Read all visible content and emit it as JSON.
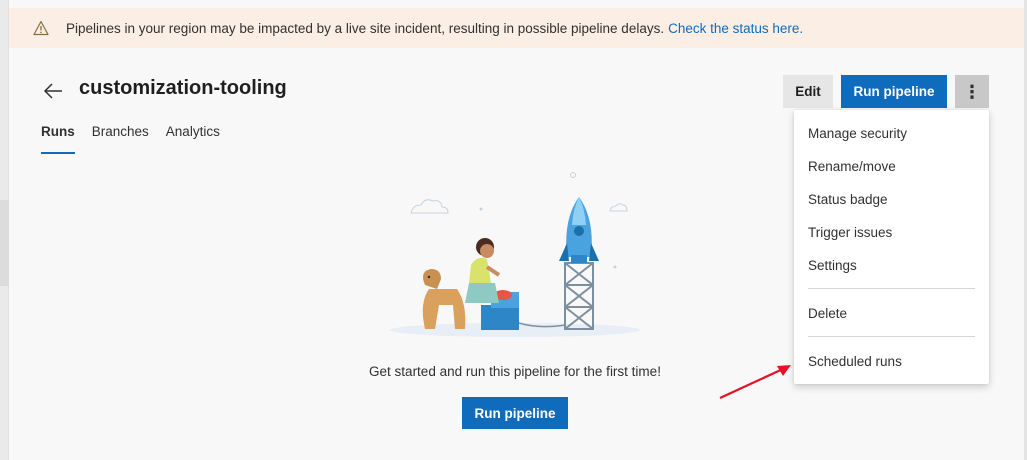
{
  "banner": {
    "icon": "warning-icon",
    "message": "Pipelines in your region may be impacted by a live site incident, resulting in possible pipeline delays.",
    "link": "Check the status here."
  },
  "header": {
    "title": "customization-tooling",
    "edit_label": "Edit",
    "run_label": "Run pipeline",
    "more_label": "⋮"
  },
  "tabs": [
    {
      "label": "Runs",
      "active": true
    },
    {
      "label": "Branches",
      "active": false
    },
    {
      "label": "Analytics",
      "active": false
    }
  ],
  "menu": {
    "items": [
      {
        "label": "Manage security"
      },
      {
        "label": "Rename/move"
      },
      {
        "label": "Status badge"
      },
      {
        "label": "Trigger issues"
      },
      {
        "label": "Settings"
      },
      {
        "label": "Delete"
      },
      {
        "label": "Scheduled runs"
      }
    ]
  },
  "empty_state": {
    "message": "Get started and run this pipeline for the first time!",
    "button_label": "Run pipeline"
  },
  "colors": {
    "accent": "#0f6cbd",
    "banner_bg": "#fbeee5",
    "annotation_arrow": "#e81123"
  }
}
